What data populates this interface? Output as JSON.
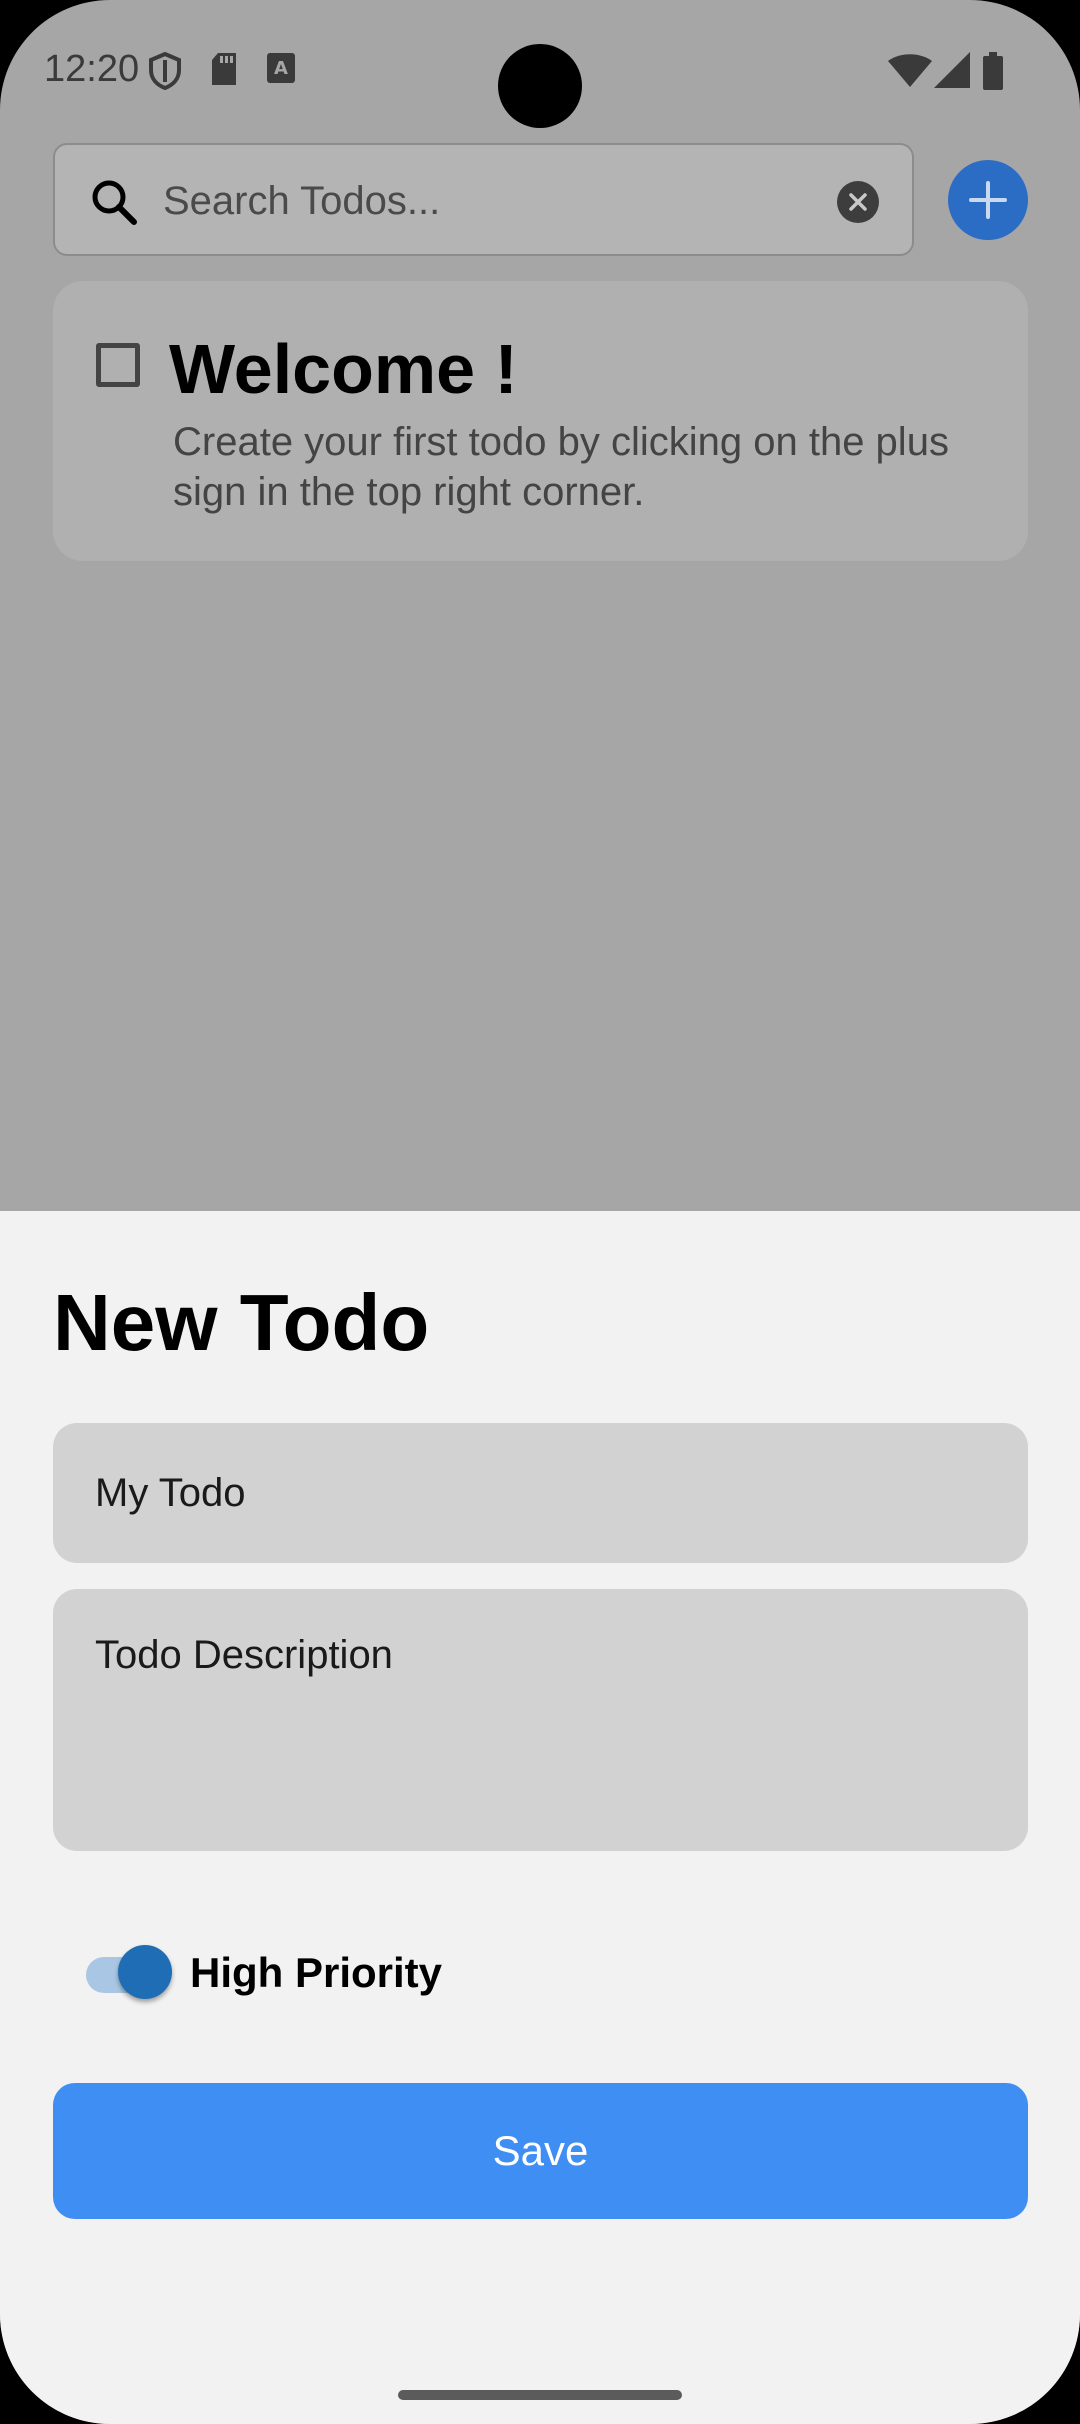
{
  "status_bar": {
    "time": "12:20",
    "left_icons": [
      "shield-icon",
      "sd-card-icon",
      "keyboard-a-icon"
    ],
    "right_icons": [
      "wifi-icon",
      "signal-icon",
      "battery-icon"
    ]
  },
  "search": {
    "placeholder": "Search Todos...",
    "value": ""
  },
  "welcome_card": {
    "title": "Welcome !",
    "text": "Create your first todo by clicking on the plus sign in the top right corner.",
    "checked": false
  },
  "sheet": {
    "title": "New Todo",
    "title_placeholder": "My Todo",
    "description_placeholder": "Todo Description",
    "priority_label": "High Priority",
    "priority_on": true,
    "save_label": "Save"
  },
  "colors": {
    "accent": "#3f8ef3",
    "fab": "#2b6cc4",
    "toggle_knob": "#1f6db5",
    "scrim": "#a6a6a6",
    "sheet_bg": "#f2f2f2"
  }
}
